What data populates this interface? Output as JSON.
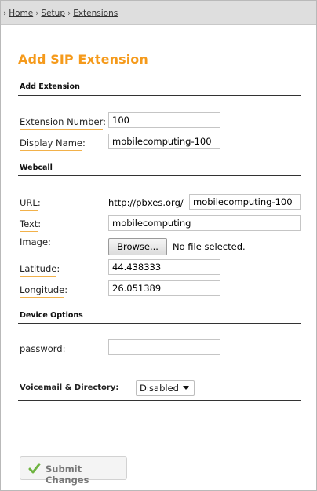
{
  "breadcrumb": {
    "arrow": "›",
    "items": [
      "Home",
      "Setup",
      "Extensions"
    ],
    "sep": "›"
  },
  "page": {
    "title": "Add SIP Extension"
  },
  "sections": {
    "add_extension": "Add Extension",
    "webcall": "Webcall",
    "device_options": "Device Options"
  },
  "fields": {
    "extension_number": {
      "label": "Extension Number",
      "suffix": ":",
      "value": "100"
    },
    "display_name": {
      "label": "Display Name",
      "suffix": ":",
      "value": "mobilecomputing-100"
    },
    "url": {
      "label": "URL",
      "suffix": ":",
      "prefix": "http://pbxes.org/",
      "value": "mobilecomputing-100"
    },
    "text": {
      "label": "Text",
      "suffix": ":",
      "value": "mobilecomputing"
    },
    "image": {
      "label": "Image:",
      "browse_label": "Browse...",
      "file_status": "No file selected."
    },
    "latitude": {
      "label": "Latitude",
      "suffix": ":",
      "value": "44.438333"
    },
    "longitude": {
      "label": "Longitude",
      "suffix": ":",
      "value": "26.051389"
    },
    "password": {
      "label": "password:",
      "value": ""
    },
    "voicemail": {
      "label": "Voicemail & Directory:",
      "selected": "Disabled"
    }
  },
  "actions": {
    "submit_label": "Submit Changes"
  },
  "colors": {
    "accent": "#f59a1b",
    "underline": "#f2b14a",
    "check": "#6db33f"
  },
  "icons": {
    "submit": "check-icon",
    "select": "chevron-down-icon"
  }
}
